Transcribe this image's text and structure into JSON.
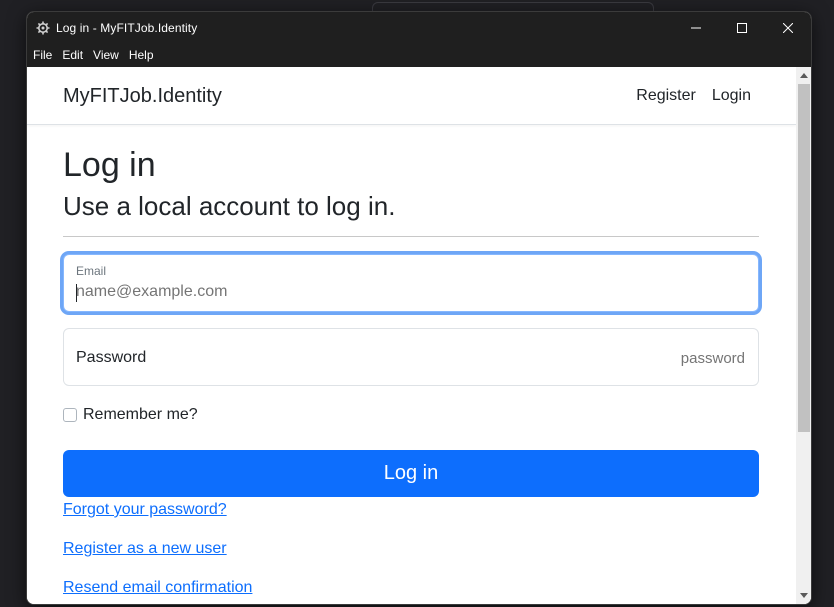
{
  "window": {
    "title": "Log in - MyFITJob.Identity",
    "icon": "app-gear-icon"
  },
  "menubar": {
    "items": [
      "File",
      "Edit",
      "View",
      "Help"
    ]
  },
  "navbar": {
    "brand": "MyFITJob.Identity",
    "links": [
      "Register",
      "Login"
    ]
  },
  "main": {
    "title": "Log in",
    "subtitle": "Use a local account to log in.",
    "email": {
      "label": "Email",
      "placeholder": "name@example.com",
      "value": ""
    },
    "password": {
      "label": "Password",
      "placeholder": "password",
      "value": ""
    },
    "remember_me": {
      "label": "Remember me?",
      "checked": false
    },
    "login_button": "Log in",
    "links": {
      "forgot_password": "Forgot your password?",
      "register": "Register as a new user",
      "resend_confirmation": "Resend email confirmation"
    }
  },
  "colors": {
    "primary": "#0d6efd",
    "focus_ring": "#6ea6f6",
    "titlebar": "#1f1f1f"
  }
}
